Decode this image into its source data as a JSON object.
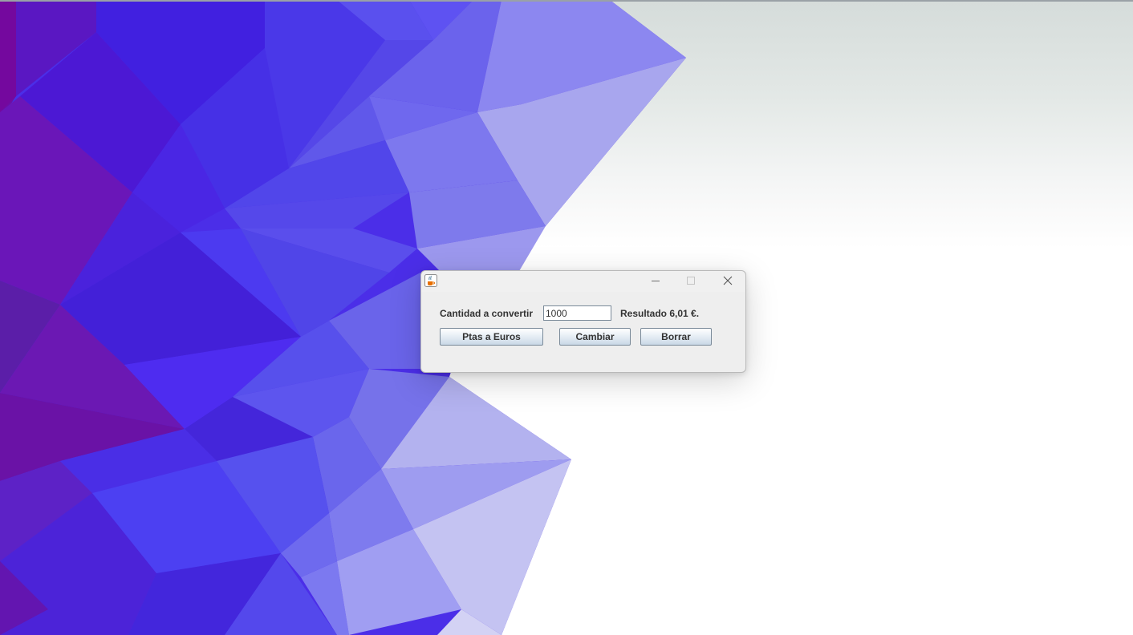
{
  "window": {
    "title": "",
    "controls": {
      "minimize_icon": "minimize-icon",
      "maximize_icon": "maximize-icon",
      "close_icon": "close-icon"
    }
  },
  "form": {
    "amount_label": "Cantidad a convertir",
    "amount_value": "1000",
    "result_text": "Resultado 6,01 €."
  },
  "buttons": {
    "convert_label": "Ptas a Euros",
    "switch_label": "Cambiar",
    "clear_label": "Borrar"
  },
  "colors": {
    "wallpaper_purple": "#6a0fa8",
    "wallpaper_blue": "#4a2ff0",
    "window_background": "#eeeeee",
    "button_gradient_bottom": "#c9d8e6"
  }
}
